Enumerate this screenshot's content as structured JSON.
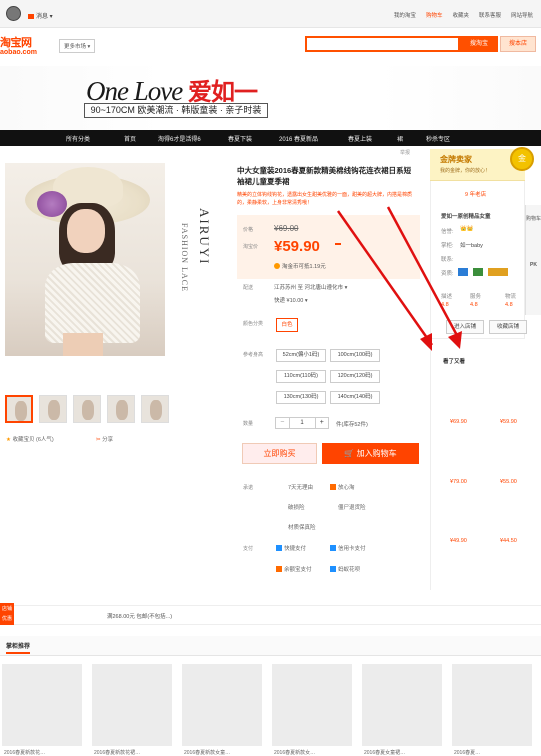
{
  "topbar": {
    "message": "消息",
    "nav": [
      "我的淘宝",
      "购物车",
      "收藏夹",
      "联系客服",
      "网站导航"
    ]
  },
  "header": {
    "logo_cn": "淘宝网",
    "logo_en": "aobao.com",
    "market": "更多市场",
    "search_btn": "搜淘宝",
    "search_btn2": "搜本店"
  },
  "banner": {
    "title_en": "One Love",
    "title_cn": "爱如一",
    "subtitle": "90~170CM 欧美潮流 · 韩版童装 · 亲子时装"
  },
  "navbar": [
    "所有分类",
    "首页",
    "淘得6才是活得6",
    "春夏下装",
    "2016 春夏新品",
    "春夏上装",
    "裙",
    "秒杀专区"
  ],
  "breadcrumb": "举报",
  "gallery": {
    "vertical_text": "AIRUYI",
    "vertical_text2": "FASHION LACE",
    "fav": "收藏宝贝 (6人气)",
    "share": "分享"
  },
  "product": {
    "title": "中大女童装2016春夏新款精美棉线钩花连衣裙日系短袖裙儿童夏季裙",
    "desc": "精美的立体钩线钩花，透露出女生甜美优雅的一面，甜美的超大牌，内搭是棉质的，柔静柔软，上身非常清秀哦！",
    "price_label": "价格",
    "price_old": "¥69.00",
    "taobao_price_label": "淘宝价",
    "price_new": "¥59.90",
    "promo_tag": "",
    "huabei": "淘金币可抵1.19元",
    "ship_label": "配送",
    "ship_from": "江苏苏州 至 河北唐山遵化市",
    "ship_fee": "快递 ¥10.00",
    "color_label": "颜色分类",
    "color_options": [
      "白色"
    ],
    "size_label": "参考身高",
    "size_options": [
      "52cm(偏小1码)",
      "100cm(100码)",
      "110cm(110码)",
      "120cm(120码)",
      "130cm(130码)",
      "140cm(140码)"
    ],
    "qty_label": "数量",
    "qty_minus": "−",
    "qty_value": "1",
    "qty_plus": "+",
    "stock": "件(库存52件)",
    "buy_now": "立即购买",
    "add_cart": "加入购物车",
    "promise_label": "承诺",
    "promises": [
      "7天无理由",
      "放心淘",
      "破损险",
      "僵尸退货险",
      "材质保真险"
    ],
    "pay_label": "支付",
    "pays": [
      "快捷支付",
      "信用卡支付",
      "余额宝支付",
      "蚂蚁花呗"
    ]
  },
  "shop": {
    "badge": "金牌卖家",
    "badge_sub": "我的金牌，你的放心！",
    "gold": "金",
    "years": "9 年老店",
    "name": "爱如一原创精品女童",
    "credit_label": "信誉:",
    "seller_label": "掌柜:",
    "seller": "如一baby",
    "contact_label": "联系:",
    "quals_label": "资质:",
    "ratings": [
      "描述",
      "服务",
      "物流"
    ],
    "scores": [
      "4.8",
      "4.8",
      "4.8"
    ],
    "btn_enter": "进入店铺",
    "btn_fav": "收藏店铺"
  },
  "sidetool": [
    "购物车",
    "PK"
  ],
  "seealso": {
    "title": "看了又看",
    "prices": [
      "¥69.90",
      "¥59.90",
      "¥79.00",
      "¥55.00",
      "¥49.90",
      "¥44.50"
    ]
  },
  "footer": {
    "left_badge": "店铺优惠",
    "promo": "满268.00元 包邮(不包括...)",
    "promo_amt": "268.00",
    "tab": "掌柜推荐",
    "rec_titles": [
      "2016春夏新款花…",
      "2016春夏新款花裙…",
      "2016春夏新款女童…",
      "2016春夏新款女…",
      "2016春夏女童裙…",
      "2016春夏…"
    ]
  },
  "colors": {
    "accent": "#ff4400",
    "nav": "#111111",
    "gold": "#f3c200",
    "arrow": "#e01010"
  }
}
